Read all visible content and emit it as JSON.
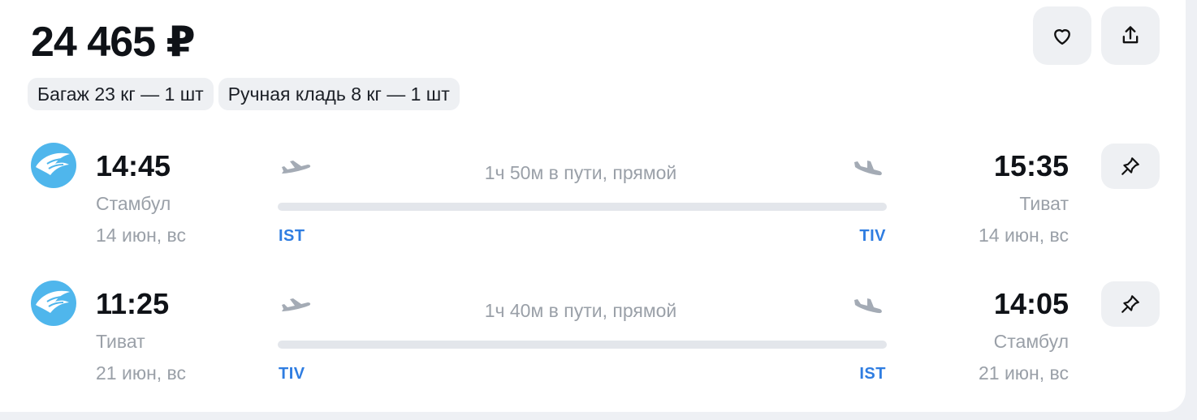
{
  "price": "24 465 ₽",
  "actions": {
    "favorite_icon": "heart-icon",
    "share_icon": "share-icon"
  },
  "baggage": [
    {
      "label": "Багаж 23 кг — 1 шт"
    },
    {
      "label": "Ручная кладь 8 кг — 1 шт"
    }
  ],
  "segments": [
    {
      "dep_time": "14:45",
      "dep_city": "Стамбул",
      "dep_date": "14 июн, вс",
      "arr_time": "15:35",
      "arr_city": "Тиват",
      "arr_date": "14 июн, вс",
      "duration": "1ч 50м в пути, прямой",
      "from_code": "IST",
      "to_code": "TIV"
    },
    {
      "dep_time": "11:25",
      "dep_city": "Тиват",
      "dep_date": "21 июн, вс",
      "arr_time": "14:05",
      "arr_city": "Стамбул",
      "arr_date": "21 июн, вс",
      "duration": "1ч 40м в пути, прямой",
      "from_code": "TIV",
      "to_code": "IST"
    }
  ],
  "colors": {
    "airline_logo": "#4fb6ec",
    "airport_code": "#2f7de1",
    "muted": "#9aa0a8"
  }
}
